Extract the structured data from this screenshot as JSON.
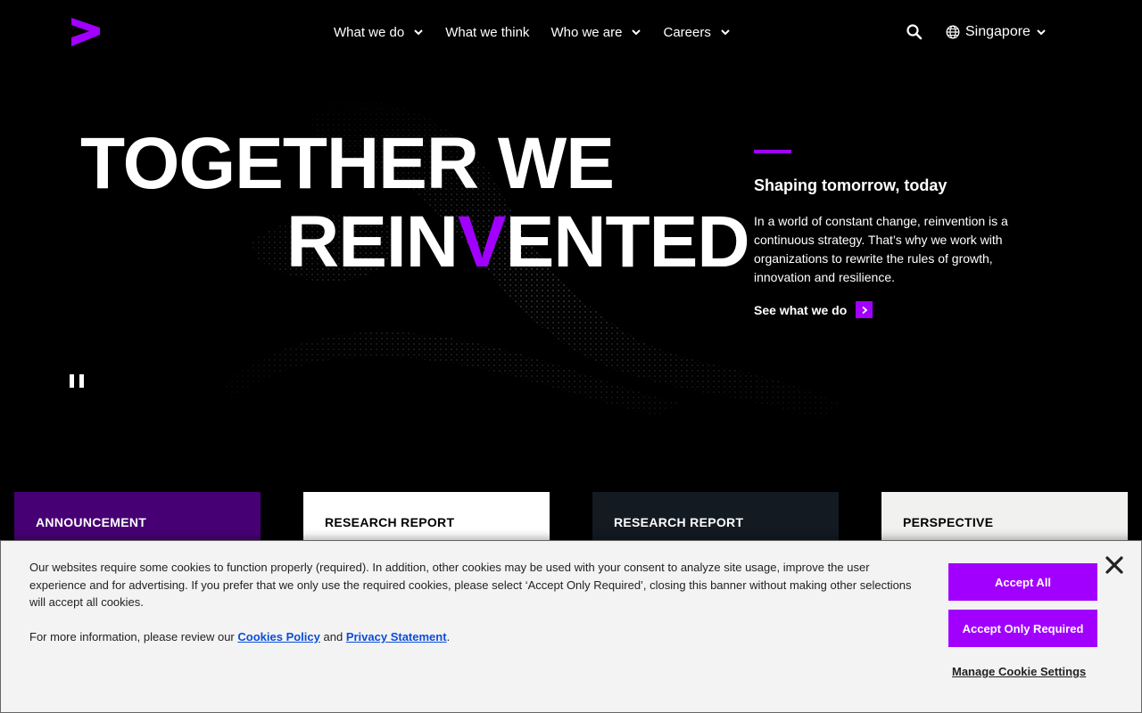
{
  "header": {
    "nav": [
      {
        "label": "What we do",
        "dropdown": true
      },
      {
        "label": "What we think",
        "dropdown": false
      },
      {
        "label": "Who we are",
        "dropdown": true
      },
      {
        "label": "Careers",
        "dropdown": true
      }
    ],
    "locale": "Singapore"
  },
  "hero": {
    "title_line1": "TOGETHER WE",
    "title_line2_a": "REIN",
    "title_line2_accent": "V",
    "title_line2_b": "ENTED",
    "subtitle": "Shaping tomorrow, today",
    "body": "In a world of constant change, reinvention is a continuous strategy. That’s why we work with organizations to rewrite the rules of growth, innovation and resilience.",
    "cta": "See what we do"
  },
  "cards": [
    {
      "label": "ANNOUNCEMENT"
    },
    {
      "label": "RESEARCH REPORT"
    },
    {
      "label": "RESEARCH REPORT"
    },
    {
      "label": "PERSPECTIVE"
    }
  ],
  "cookie": {
    "text": "Our websites require some cookies to function properly (required). In addition, other cookies may be used with your consent to analyze site usage, improve the user experience and for advertising. If you prefer that we only use the required cookies, please select ‘Accept Only Required’, closing this banner without making other selections will accept all cookies.",
    "more_prefix": "For more information, please review our",
    "cookies_policy": "Cookies Policy",
    "and": "and",
    "privacy_statement": "Privacy Statement",
    "period": ".",
    "accept_all": "Accept All",
    "accept_required": "Accept Only Required",
    "manage": "Manage Cookie Settings"
  },
  "colors": {
    "accent": "#a100ff",
    "card_purple": "#460073",
    "link_blue": "#0a4ed8"
  },
  "icons": [
    "brand-logo-icon",
    "chevron-down-icon",
    "search-icon",
    "globe-icon",
    "arrow-right-icon",
    "pause-icon",
    "close-icon"
  ]
}
